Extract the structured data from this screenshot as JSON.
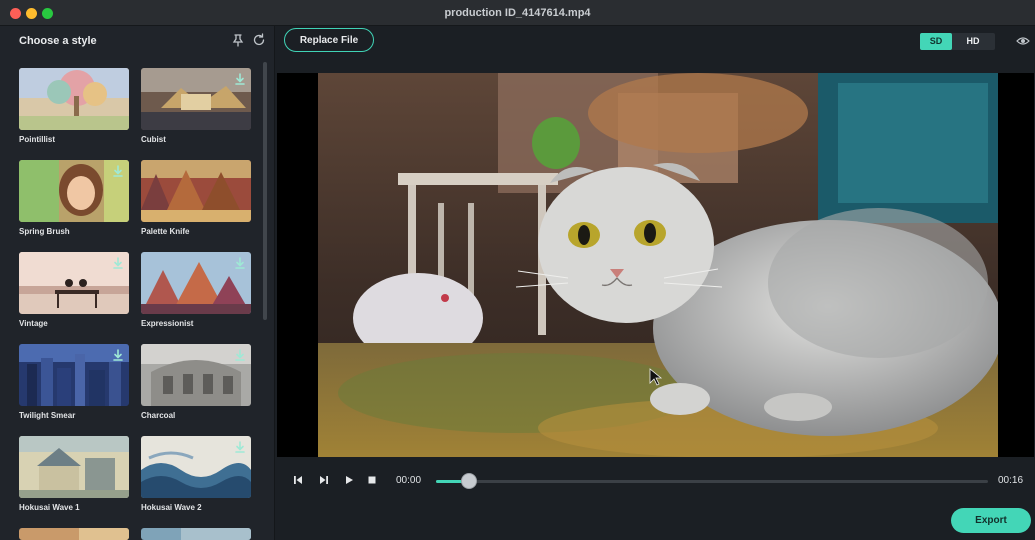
{
  "window": {
    "title": "production ID_4147614.mp4"
  },
  "sidebar": {
    "title": "Choose a style",
    "styles": [
      {
        "label": "Pointillist"
      },
      {
        "label": "Cubist"
      },
      {
        "label": "Spring Brush"
      },
      {
        "label": "Palette Knife"
      },
      {
        "label": "Vintage"
      },
      {
        "label": "Expressionist"
      },
      {
        "label": "Twilight Smear"
      },
      {
        "label": "Charcoal"
      },
      {
        "label": "Hokusai Wave 1"
      },
      {
        "label": "Hokusai Wave 2"
      }
    ]
  },
  "toolbar": {
    "replace_label": "Replace File",
    "sd_label": "SD",
    "hd_label": "HD",
    "selected_quality": "SD"
  },
  "player": {
    "current_time": "00:00",
    "duration": "00:16",
    "progress": 0.06
  },
  "export_label": "Export",
  "colors": {
    "accent": "#43d6b7",
    "background": "#1b1f24",
    "sidebar": "#20242a"
  },
  "icons": [
    "pin-icon",
    "refresh-icon",
    "eye-icon",
    "download-icon",
    "step-back-icon",
    "step-forward-icon",
    "play-icon",
    "stop-icon"
  ]
}
